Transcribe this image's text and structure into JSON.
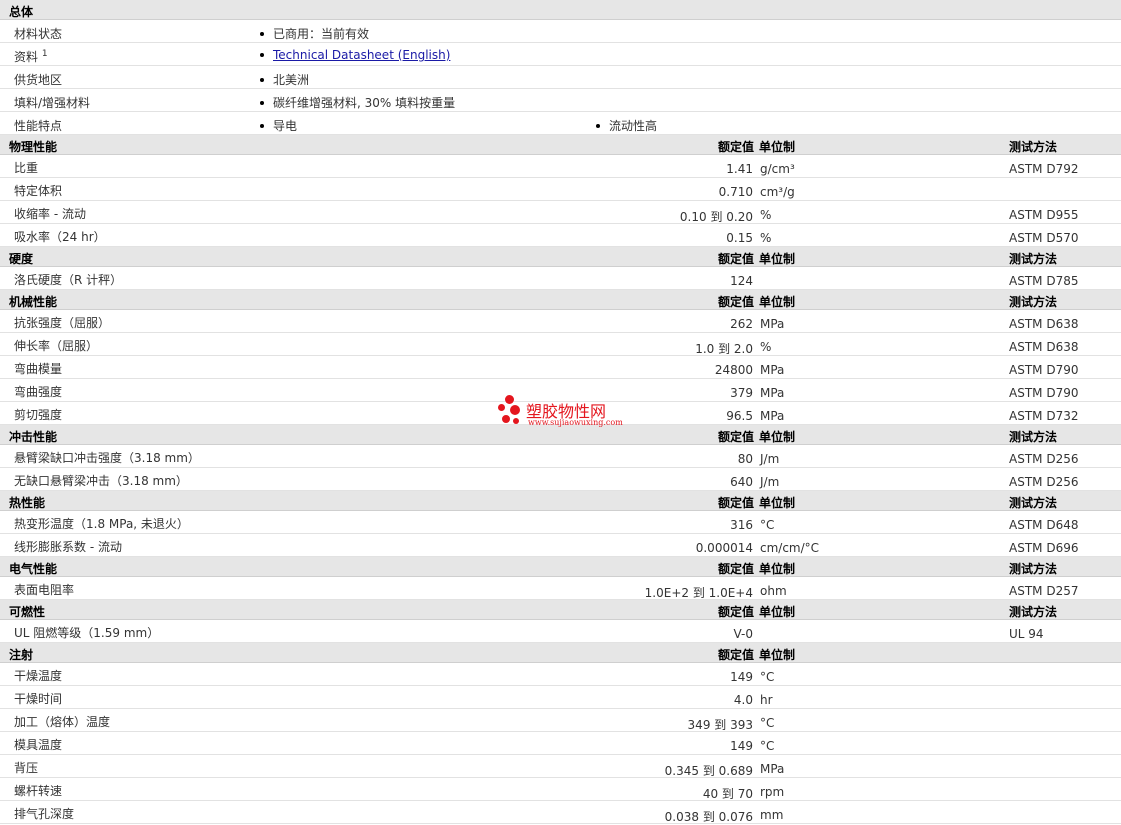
{
  "general": {
    "title": "总体",
    "rows": [
      {
        "label": "材料状态",
        "value": "已商用：当前有效"
      },
      {
        "label": "资料",
        "sup": "1",
        "value": "Technical Datasheet (English)"
      },
      {
        "label": "供货地区",
        "value": "北美洲"
      },
      {
        "label": "填料/增强材料",
        "value": "碳纤维增强材料, 30% 填料按重量"
      },
      {
        "label": "性能特点",
        "value": "导电",
        "value2": "流动性高"
      }
    ]
  },
  "columns": {
    "nominal": "额定值",
    "unit": "单位制",
    "method": "测试方法"
  },
  "physical": {
    "title": "物理性能",
    "rows": [
      {
        "label": "比重",
        "nominal": "1.41",
        "unit": "g/cm³",
        "method": "ASTM D792"
      },
      {
        "label": "特定体积",
        "nominal": "0.710",
        "unit": "cm³/g",
        "method": ""
      },
      {
        "label": "收缩率 - 流动",
        "nominal": "0.10 到 0.20",
        "unit": "%",
        "method": "ASTM D955"
      },
      {
        "label": "吸水率（24 hr）",
        "nominal": "0.15",
        "unit": "%",
        "method": "ASTM D570"
      }
    ]
  },
  "hardness": {
    "title": "硬度",
    "rows": [
      {
        "label": "洛氏硬度（R 计秤）",
        "nominal": "124",
        "unit": "",
        "method": "ASTM D785"
      }
    ]
  },
  "mechanical": {
    "title": "机械性能",
    "rows": [
      {
        "label": "抗张强度（屈服）",
        "nominal": "262",
        "unit": "MPa",
        "method": "ASTM D638"
      },
      {
        "label": "伸长率（屈服）",
        "nominal": "1.0 到 2.0",
        "unit": "%",
        "method": "ASTM D638"
      },
      {
        "label": "弯曲模量",
        "nominal": "24800",
        "unit": "MPa",
        "method": "ASTM D790"
      },
      {
        "label": "弯曲强度",
        "nominal": "379",
        "unit": "MPa",
        "method": "ASTM D790"
      },
      {
        "label": "剪切强度",
        "nominal": "96.5",
        "unit": "MPa",
        "method": "ASTM D732"
      }
    ]
  },
  "impact": {
    "title": "冲击性能",
    "rows": [
      {
        "label": "悬臂梁缺口冲击强度（3.18 mm）",
        "nominal": "80",
        "unit": "J/m",
        "method": "ASTM D256"
      },
      {
        "label": "无缺口悬臂梁冲击（3.18 mm）",
        "nominal": "640",
        "unit": "J/m",
        "method": "ASTM D256"
      }
    ]
  },
  "thermal": {
    "title": "热性能",
    "rows": [
      {
        "label": "热变形温度（1.8 MPa, 未退火）",
        "nominal": "316",
        "unit": "°C",
        "method": "ASTM D648"
      },
      {
        "label": "线形膨胀系数 - 流动",
        "nominal": "0.000014",
        "unit": "cm/cm/°C",
        "method": "ASTM D696"
      }
    ]
  },
  "electrical": {
    "title": "电气性能",
    "rows": [
      {
        "label": "表面电阻率",
        "nominal": "1.0E+2 到 1.0E+4",
        "unit": "ohm",
        "method": "ASTM D257"
      }
    ]
  },
  "flammability": {
    "title": "可燃性",
    "rows": [
      {
        "label": "UL 阻燃等级（1.59 mm）",
        "nominal": "V-0",
        "unit": "",
        "method": "UL 94"
      }
    ]
  },
  "injection": {
    "title": "注射",
    "rows": [
      {
        "label": "干燥温度",
        "nominal": "149",
        "unit": "°C"
      },
      {
        "label": "干燥时间",
        "nominal": "4.0",
        "unit": "hr"
      },
      {
        "label": "加工（熔体）温度",
        "nominal": "349 到 393",
        "unit": "°C"
      },
      {
        "label": "模具温度",
        "nominal": "149",
        "unit": "°C"
      },
      {
        "label": "背压",
        "nominal": "0.345 到 0.689",
        "unit": "MPa"
      },
      {
        "label": "螺杆转速",
        "nominal": "40 到 70",
        "unit": "rpm"
      },
      {
        "label": "排气孔深度",
        "nominal": "0.038 到 0.076",
        "unit": "mm"
      }
    ]
  },
  "watermark": {
    "text": "塑胶物性网",
    "sub": "www.sujiaowuxing.com",
    "color": "#e4161e"
  }
}
